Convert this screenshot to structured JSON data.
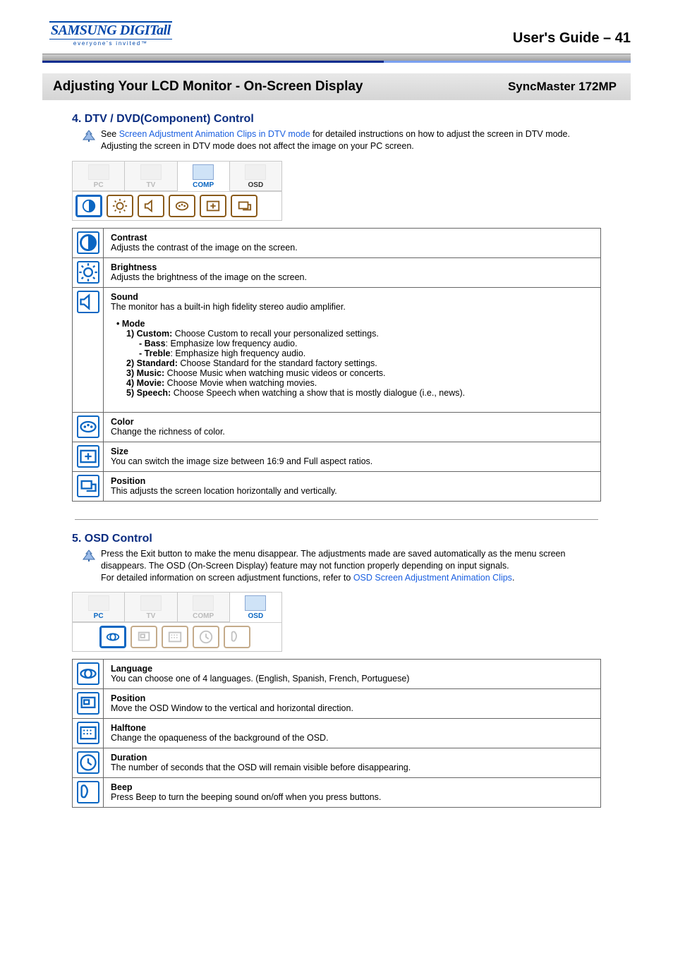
{
  "header": {
    "logo_line1": "SAMSUNG DIGITall",
    "logo_line2": "everyone's invited™",
    "right_prefix": "User's Guide",
    "right_sep": " – ",
    "right_page": "41"
  },
  "titlebar": {
    "left": "Adjusting Your LCD Monitor - On-Screen Display",
    "right": "SyncMaster 172MP"
  },
  "section4": {
    "heading": "4. DTV / DVD(Component) Control",
    "note_pre": "See ",
    "note_link": "Screen Adjustment Animation Clips in DTV mode",
    "note_post": " for detailed instructions on how to adjust the screen in DTV mode. Adjusting the screen in DTV mode does not affect the image on your PC screen.",
    "tabs": [
      "PC",
      "TV",
      "COMP",
      "OSD"
    ],
    "items": {
      "contrast": {
        "title": "Contrast",
        "desc": "Adjusts the contrast of the image on the screen."
      },
      "brightness": {
        "title": "Brightness",
        "desc": "Adjusts the brightness of the image on the screen."
      },
      "sound": {
        "title": "Sound",
        "desc": "The monitor has a built-in high fidelity stereo audio amplifier.",
        "mode_label": "• Mode",
        "m1_pre": "1) Custom:",
        "m1_post": " Choose Custom to recall your personalized settings.",
        "bass_pre": "- Bass",
        "bass_post": ": Emphasize low frequency audio.",
        "treble_pre": "- Treble",
        "treble_post": ": Emphasize high frequency audio.",
        "m2_pre": "2) Standard:",
        "m2_post": " Choose Standard for the standard factory settings.",
        "m3_pre": "3) Music:",
        "m3_post": " Choose Music when watching music videos or concerts.",
        "m4_pre": "4) Movie:",
        "m4_post": " Choose Movie when watching movies.",
        "m5_pre": "5) Speech:",
        "m5_post": " Choose Speech when watching a show that is mostly dialogue (i.e., news)."
      },
      "color": {
        "title": "Color",
        "desc": "Change the richness of color."
      },
      "size": {
        "title": "Size",
        "desc": "You can switch the image size between 16:9 and Full aspect ratios."
      },
      "position": {
        "title": "Position",
        "desc": "This adjusts the screen location horizontally and vertically."
      }
    }
  },
  "section5": {
    "heading": "5. OSD Control",
    "note1": "Press the Exit button to make the menu disappear. The adjustments made are saved automatically as the menu screen disappears. The OSD (On-Screen Display) feature may not function properly depending on input signals.",
    "note2_pre": "For detailed information on screen adjustment functions, refer to ",
    "note2_link": "OSD Screen Adjustment Animation Clips",
    "note2_post": ".",
    "tabs": [
      "PC",
      "TV",
      "COMP",
      "OSD"
    ],
    "items": {
      "language": {
        "title": "Language",
        "desc": "You can choose one of 4 languages. (English, Spanish, French, Portuguese)"
      },
      "position": {
        "title": "Position",
        "desc": "Move the OSD Window to the vertical and horizontal direction."
      },
      "halftone": {
        "title": "Halftone",
        "desc": "Change the opaqueness of the background of the OSD."
      },
      "duration": {
        "title": "Duration",
        "desc": "The number of seconds that the OSD will remain visible before disappearing."
      },
      "beep": {
        "title": "Beep",
        "desc": "Press Beep to turn the beeping sound on/off when you press buttons."
      }
    }
  }
}
